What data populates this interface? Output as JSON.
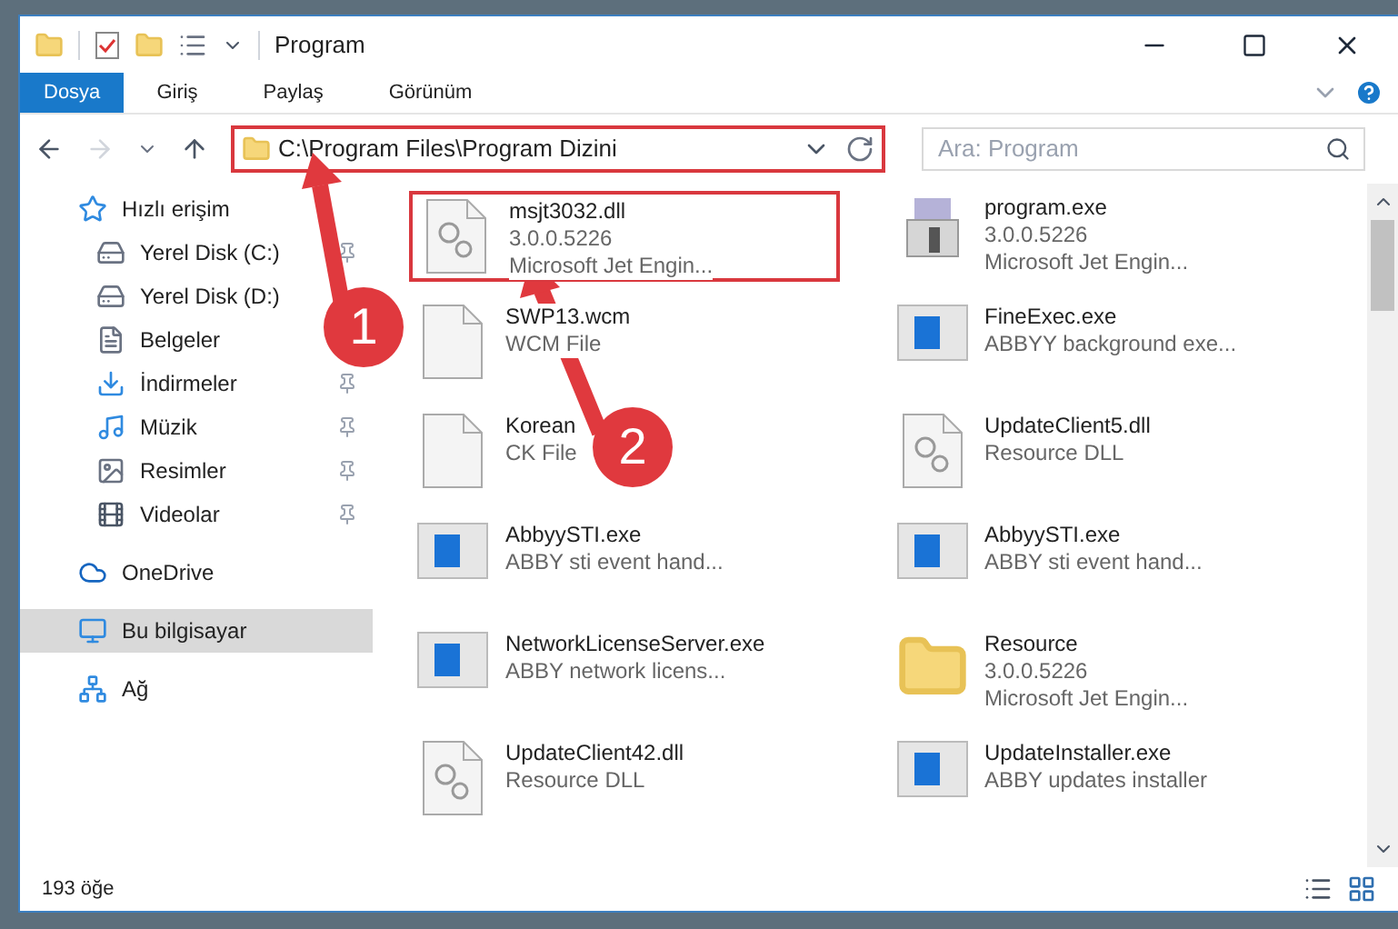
{
  "window": {
    "title": "Program"
  },
  "ribbon_tabs": [
    {
      "label": "Dosya",
      "selected": true
    },
    {
      "label": "Giriş",
      "selected": false
    },
    {
      "label": "Paylaş",
      "selected": false
    },
    {
      "label": "Görünüm",
      "selected": false
    }
  ],
  "address_bar": {
    "value": "C:\\Program Files\\Program Dizini"
  },
  "search": {
    "placeholder": "Ara: Program"
  },
  "sidebar": {
    "items": [
      {
        "label": "Hızlı erişim",
        "kind": "star",
        "selected": false,
        "children": [
          {
            "label": "Yerel Disk (C:)",
            "kind": "drive",
            "selected": false,
            "pinned": true
          },
          {
            "label": "Yerel Disk (D:)",
            "kind": "drive",
            "selected": false
          },
          {
            "label": "Belgeler",
            "kind": "documents",
            "selected": false
          },
          {
            "label": "İndirmeler",
            "kind": "downloads",
            "selected": false,
            "pinned": true
          },
          {
            "label": "Müzik",
            "kind": "music",
            "selected": false,
            "pinned": true
          },
          {
            "label": "Resimler",
            "kind": "pictures",
            "selected": false,
            "pinned": true
          },
          {
            "label": "Videolar",
            "kind": "videos",
            "selected": false,
            "pinned": true
          }
        ]
      },
      {
        "label": "OneDrive",
        "kind": "cloud",
        "selected": false
      },
      {
        "label": "Bu bilgisayar",
        "kind": "computer",
        "selected": true
      },
      {
        "label": "Ağ",
        "kind": "network",
        "selected": false
      }
    ]
  },
  "files": [
    {
      "name": "msjt3032.dll",
      "kind": "gear",
      "details": [
        "3.0.0.5226",
        "Microsoft Jet Engin..."
      ],
      "highlighted": true
    },
    {
      "name": "program.exe",
      "kind": "installer",
      "details": [
        "3.0.0.5226",
        "Microsoft Jet Engin..."
      ],
      "highlighted": false
    },
    {
      "name": "SWP13.wcm",
      "kind": "blank",
      "details": [
        "WCM File"
      ],
      "highlighted": false
    },
    {
      "name": "FineExec.exe",
      "kind": "app",
      "details": [
        "ABBYY background exe..."
      ],
      "highlighted": false
    },
    {
      "name": "Korean",
      "kind": "blank",
      "details": [
        "CK File"
      ],
      "highlighted": false
    },
    {
      "name": "UpdateClient5.dll",
      "kind": "gear",
      "details": [
        "Resource DLL"
      ],
      "highlighted": false
    },
    {
      "name": "AbbyySTI.exe",
      "kind": "app",
      "details": [
        "ABBY sti event hand..."
      ],
      "highlighted": false
    },
    {
      "name": "AbbyySTI.exe",
      "kind": "app",
      "details": [
        "ABBY sti event hand..."
      ],
      "highlighted": false
    },
    {
      "name": "NetworkLicenseServer.exe",
      "kind": "app",
      "details": [
        "ABBY network licens..."
      ],
      "highlighted": false
    },
    {
      "name": "Resource",
      "kind": "folder",
      "details": [
        "3.0.0.5226",
        "Microsoft Jet Engin..."
      ],
      "highlighted": false
    },
    {
      "name": "UpdateClient42.dll",
      "kind": "gear",
      "details": [
        "Resource DLL"
      ],
      "highlighted": false
    },
    {
      "name": "UpdateInstaller.exe",
      "kind": "app",
      "details": [
        "ABBY updates installer"
      ],
      "highlighted": false
    }
  ],
  "status_bar": {
    "count": "193 öğe"
  },
  "annotations": [
    {
      "label": "1"
    },
    {
      "label": "2"
    }
  ]
}
